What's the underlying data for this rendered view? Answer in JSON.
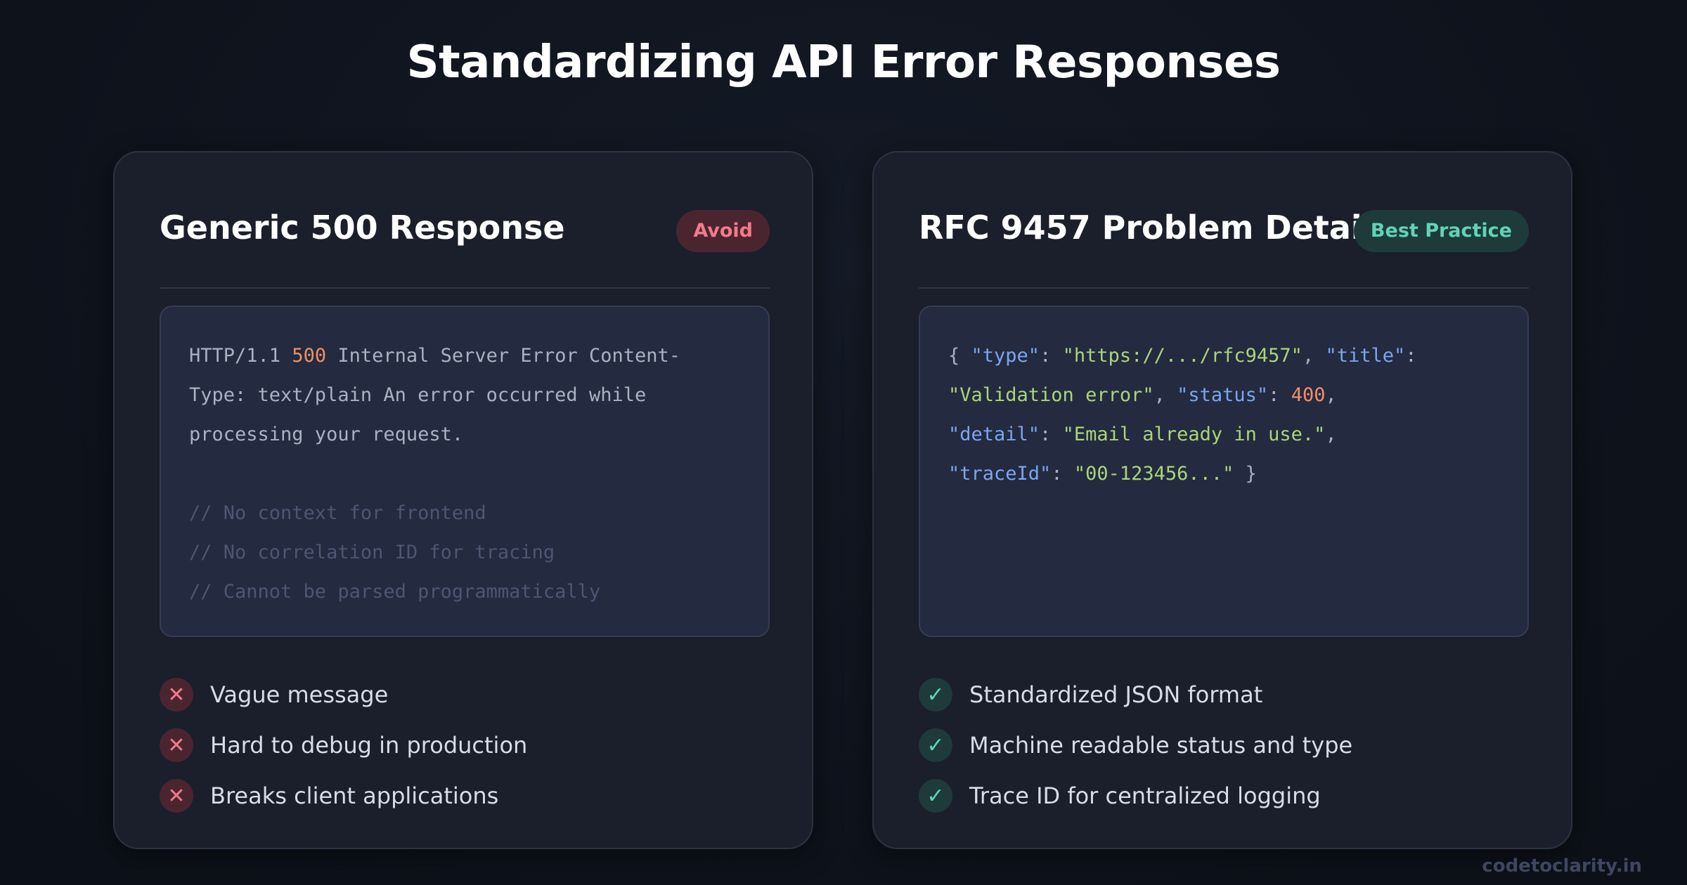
{
  "page": {
    "title": "Standardizing API Error Responses"
  },
  "left_card": {
    "title": "Generic 500 Response",
    "badge": "Avoid",
    "code": {
      "line1_a": "HTTP/1.1 ",
      "line1_num": "500",
      "line1_b": " Internal Server Error Content-",
      "line2": "Type: text/plain An error occurred while",
      "line3": "processing your request.",
      "comments": [
        "// No context for frontend",
        "// No correlation ID for tracing",
        "// Cannot be parsed programmatically"
      ]
    },
    "bullets": [
      {
        "icon": "x-icon",
        "text": "Vague message"
      },
      {
        "icon": "x-icon",
        "text": "Hard to debug in production"
      },
      {
        "icon": "x-icon",
        "text": "Breaks client applications"
      }
    ]
  },
  "right_card": {
    "title": "RFC 9457 Problem Details",
    "badge": "Best Practice",
    "code": {
      "open_brace": "{ ",
      "type_key": "\"type\"",
      "type_val": "\"https://.../rfc9457\"",
      "title_key": "\"title\"",
      "title_val": "\"Validation error\"",
      "status_key": "\"status\"",
      "status_val": "400",
      "detail_key": "\"detail\"",
      "detail_val": "\"Email already in use.\"",
      "trace_key": "\"traceId\"",
      "trace_val": "\"00-123456...\"",
      "close_brace": " }",
      "colon": ": ",
      "comma": ", ",
      "comma_end": ","
    },
    "bullets": [
      {
        "icon": "check-icon",
        "text": "Standardized JSON format"
      },
      {
        "icon": "check-icon",
        "text": "Machine readable status and type"
      },
      {
        "icon": "check-icon",
        "text": "Trace ID for centralized logging"
      }
    ]
  },
  "icons": {
    "x_glyph": "✕",
    "check_glyph": "✓"
  },
  "colors": {
    "avoid": "#f27a8a",
    "best_practice": "#5fd4b6",
    "code_key": "#7aa6f0",
    "code_string": "#a9d67a",
    "code_number": "#f0906a"
  },
  "footer": {
    "brand": "codetoclarity.in"
  }
}
